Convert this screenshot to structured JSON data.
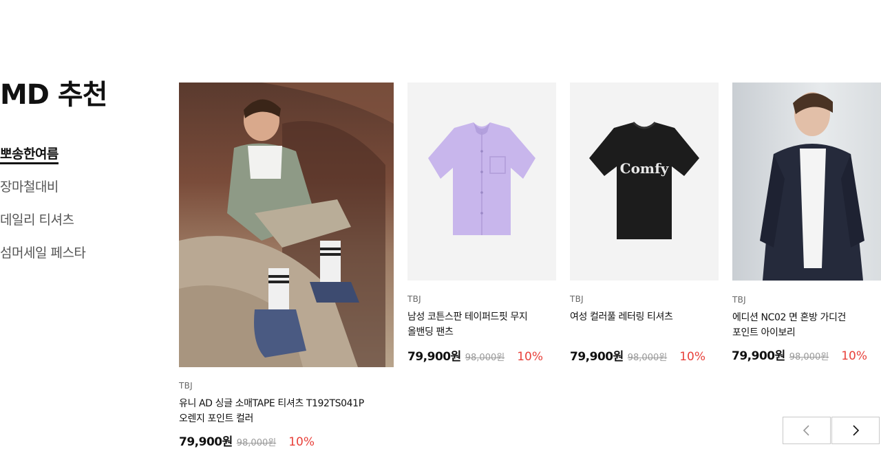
{
  "section": {
    "title": "MD 추천"
  },
  "categories": [
    {
      "label": "뽀송한여름",
      "active": true
    },
    {
      "label": "장마철대비",
      "active": false
    },
    {
      "label": "데일리 티셔츠",
      "active": false
    },
    {
      "label": "섬머세일 페스타",
      "active": false
    }
  ],
  "products": [
    {
      "brand": "TBJ",
      "name_line1": "유니 AD 싱글 소매TAPE 티셔츠 T192TS041P",
      "name_line2": "오렌지 포인트 컬러",
      "price": "79,900원",
      "original_price": "98,000원",
      "discount": "10%",
      "image_logo": ""
    },
    {
      "brand": "TBJ",
      "name_line1": "남성 코튼스판 테이퍼드핏 무지",
      "name_line2": "올밴딩 팬츠",
      "price": "79,900원",
      "original_price": "98,000원",
      "discount": "10%",
      "image_logo": ""
    },
    {
      "brand": "TBJ",
      "name_line1": "여성 컬러풀 레터링 티셔츠",
      "name_line2": "",
      "price": "79,900원",
      "original_price": "98,000원",
      "discount": "10%",
      "image_logo": "Comfy"
    },
    {
      "brand": "TBJ",
      "name_line1": "에디션 NC02 면 혼방 가디건",
      "name_line2": "포인트 아이보리",
      "price": "79,900원",
      "original_price": "98,000원",
      "discount": "10%",
      "image_logo": ""
    }
  ],
  "colors": {
    "accent_discount": "#e8403a",
    "text": "#111111",
    "muted": "#999999"
  },
  "icons": {
    "prev": "chevron-left-icon",
    "next": "chevron-right-icon"
  }
}
